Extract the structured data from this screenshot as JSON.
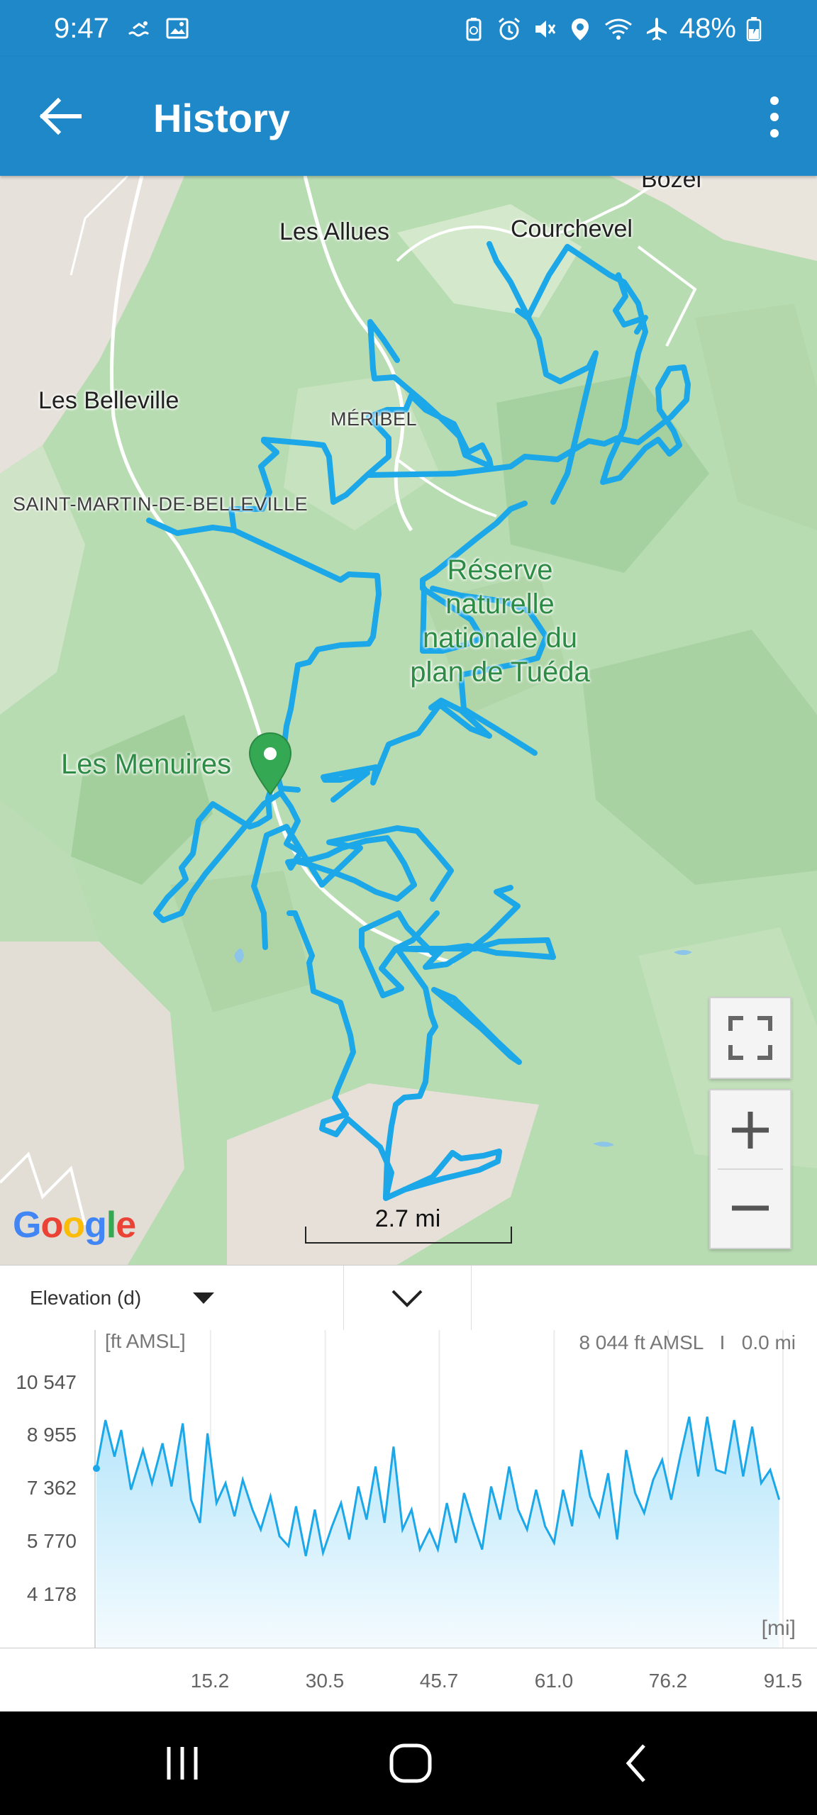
{
  "status_bar": {
    "time": "9:47",
    "battery": "48%",
    "icons": [
      "swim-icon",
      "image-icon",
      "battery-saver-icon",
      "alarm-icon",
      "mute-icon",
      "location-icon",
      "wifi-icon",
      "airplane-icon",
      "battery-charging-icon"
    ]
  },
  "app_bar": {
    "title": "History",
    "back_icon": "back-arrow-icon",
    "menu_icon": "more-vert-icon"
  },
  "map": {
    "labels": {
      "bozel": "Bozel",
      "les_allues": "Les Allues",
      "courchevel": "Courchevel",
      "les_belleville": "Les Belleville",
      "meribel": "MÉRIBEL",
      "saint_martin": "SAINT-MARTIN-DE-BELLEVILLE",
      "reserve_line1": "Réserve",
      "reserve_line2": "naturelle",
      "reserve_line3": "nationale du",
      "reserve_line4": "plan de Tuéda",
      "les_menuires": "Les Menuires"
    },
    "route_color": "#1ba7e8",
    "marker_color": "#34a853",
    "attribution": "Google",
    "scale_label": "2.7 mi",
    "controls": [
      "fullscreen-icon",
      "zoom-in-icon",
      "zoom-out-icon"
    ]
  },
  "elevation_panel": {
    "dropdown_label": "Elevation (d)",
    "toggle_icon": "chevron-down-icon",
    "y_unit": "[ft AMSL]",
    "readout": "8 044 ft AMSL   I   0.0 mi",
    "x_unit": "[mi]"
  },
  "chart_data": {
    "type": "area",
    "xlabel": "[mi]",
    "ylabel": "[ft AMSL]",
    "y_ticks": [
      "10 547",
      "8 955",
      "7 362",
      "5 770",
      "4 178"
    ],
    "x_ticks": [
      "15.2",
      "30.5",
      "45.7",
      "61.0",
      "76.2",
      "91.5"
    ],
    "xlim": [
      0,
      91.5
    ],
    "ylim": [
      4178,
      10547
    ],
    "color": "#1ba7e8",
    "x": [
      0,
      1.2,
      2.4,
      3.3,
      4.6,
      6.2,
      7.4,
      8.8,
      10,
      11.5,
      12.6,
      13.8,
      14.8,
      16,
      17.2,
      18.4,
      19.5,
      20.8,
      21.9,
      23.2,
      24.4,
      25.6,
      26.6,
      27.9,
      29.1,
      30.2,
      31.4,
      32.6,
      33.7,
      34.9,
      36,
      37.2,
      38.4,
      39.6,
      40.8,
      42,
      43.1,
      44.4,
      45.5,
      46.7,
      47.9,
      49,
      50.2,
      51.4,
      52.6,
      53.8,
      55,
      56.2,
      57.4,
      58.6,
      59.8,
      61,
      62.2,
      63.4,
      64.6,
      65.8,
      67,
      68.2,
      69.4,
      70.6,
      71.8,
      73,
      74.2,
      75.4,
      76.6,
      77.8,
      79,
      80.2,
      81.4,
      82.6,
      83.8,
      85,
      86.2,
      87.4,
      88.6,
      89.8,
      91
    ],
    "y": [
      8044,
      9500,
      8400,
      9200,
      7400,
      8600,
      7600,
      8800,
      7500,
      9400,
      7100,
      6400,
      9100,
      7000,
      7600,
      6600,
      7700,
      6800,
      6200,
      7200,
      6000,
      5700,
      6900,
      5400,
      6800,
      5500,
      6300,
      7000,
      5900,
      7500,
      6500,
      8100,
      6400,
      8700,
      6200,
      6800,
      5600,
      6200,
      5600,
      7000,
      5800,
      7300,
      6400,
      5600,
      7500,
      6500,
      8100,
      6800,
      6200,
      7400,
      6300,
      5800,
      7400,
      6300,
      8600,
      7200,
      6600,
      7900,
      5900,
      8600,
      7300,
      6700,
      7700,
      8300,
      7100,
      8400,
      9600,
      7800,
      9600,
      8000,
      7900,
      9500,
      7800,
      9300,
      7600,
      8000,
      7100
    ]
  },
  "nav_bar": {
    "icons": [
      "recent-apps-icon",
      "home-icon",
      "back-icon"
    ]
  }
}
